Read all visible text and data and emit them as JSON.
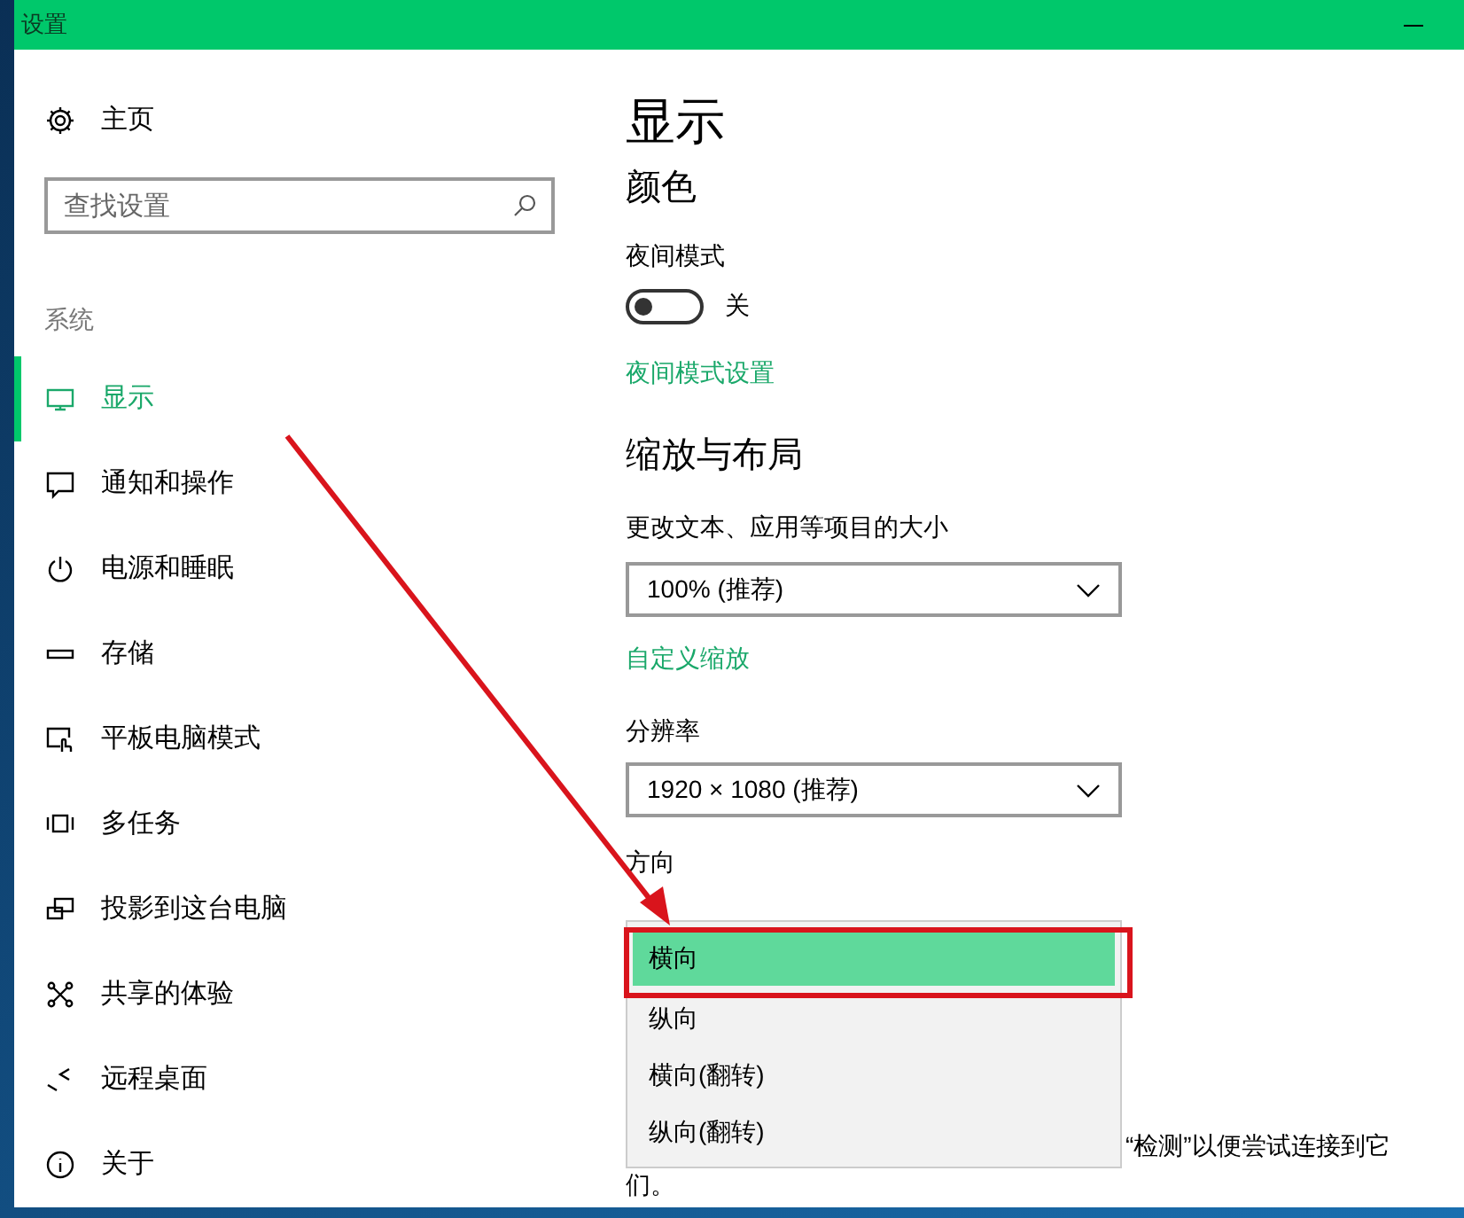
{
  "window": {
    "title": "设置"
  },
  "sidebar": {
    "home": "主页",
    "search": {
      "placeholder": "查找设置"
    },
    "section": "系统",
    "items": [
      {
        "label": "显示",
        "selected": true
      },
      {
        "label": "通知和操作",
        "selected": false
      },
      {
        "label": "电源和睡眠",
        "selected": false
      },
      {
        "label": "存储",
        "selected": false
      },
      {
        "label": "平板电脑模式",
        "selected": false
      },
      {
        "label": "多任务",
        "selected": false
      },
      {
        "label": "投影到这台电脑",
        "selected": false
      },
      {
        "label": "共享的体验",
        "selected": false
      },
      {
        "label": "远程桌面",
        "selected": false
      },
      {
        "label": "关于",
        "selected": false
      }
    ]
  },
  "content": {
    "title": "显示",
    "color_heading": "颜色",
    "night_mode": {
      "label": "夜间模式",
      "on": false,
      "state_text": "关"
    },
    "night_link": "夜间模式设置",
    "scale_heading": "缩放与布局",
    "scale": {
      "label": "更改文本、应用等项目的大小",
      "value": "100% (推荐)"
    },
    "custom_link": "自定义缩放",
    "resolution": {
      "label": "分辨率",
      "value": "1920 × 1080 (推荐)"
    },
    "orientation": {
      "label": "方向",
      "options": [
        {
          "label": "横向",
          "selected": true
        },
        {
          "label": "纵向",
          "selected": false
        },
        {
          "label": "横向(翻转)",
          "selected": false
        },
        {
          "label": "纵向(翻转)",
          "selected": false
        }
      ]
    },
    "note_lines": [
      "“检测”以便尝试连接到它",
      "们。"
    ]
  }
}
